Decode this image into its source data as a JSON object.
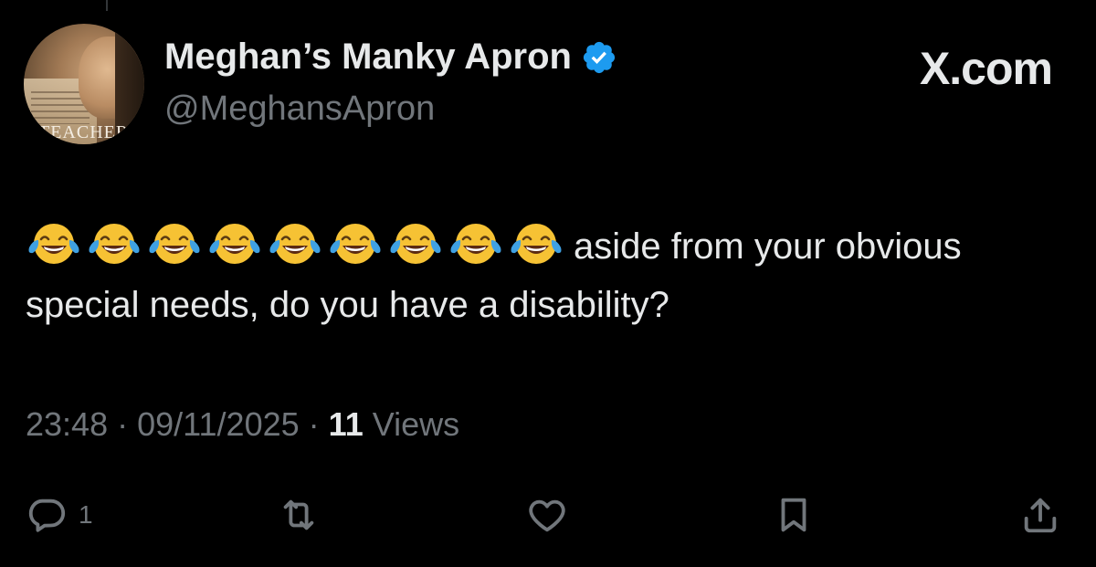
{
  "tweet": {
    "author": {
      "display_name": "Meghan’s Manky Apron",
      "handle": "@MeghansApron",
      "verified": true,
      "avatar_caption": "TEACHER"
    },
    "site_label": "X.com",
    "emoji": {
      "name": "face-with-tears-of-joy",
      "count": 9
    },
    "text_after_emoji": "aside from your obvious special needs, do you have a disability?",
    "time": "23:48",
    "separator": "·",
    "date": "09/11/2025",
    "views_count": "11",
    "views_label": "Views",
    "actions": {
      "reply_count": "1",
      "icons": [
        "reply-icon",
        "retweet-icon",
        "like-icon",
        "bookmark-icon",
        "share-icon"
      ]
    }
  },
  "colors": {
    "background": "#000000",
    "text_primary": "#e7e9ea",
    "text_secondary": "#71767b",
    "verified_blue": "#1d9bf0"
  }
}
